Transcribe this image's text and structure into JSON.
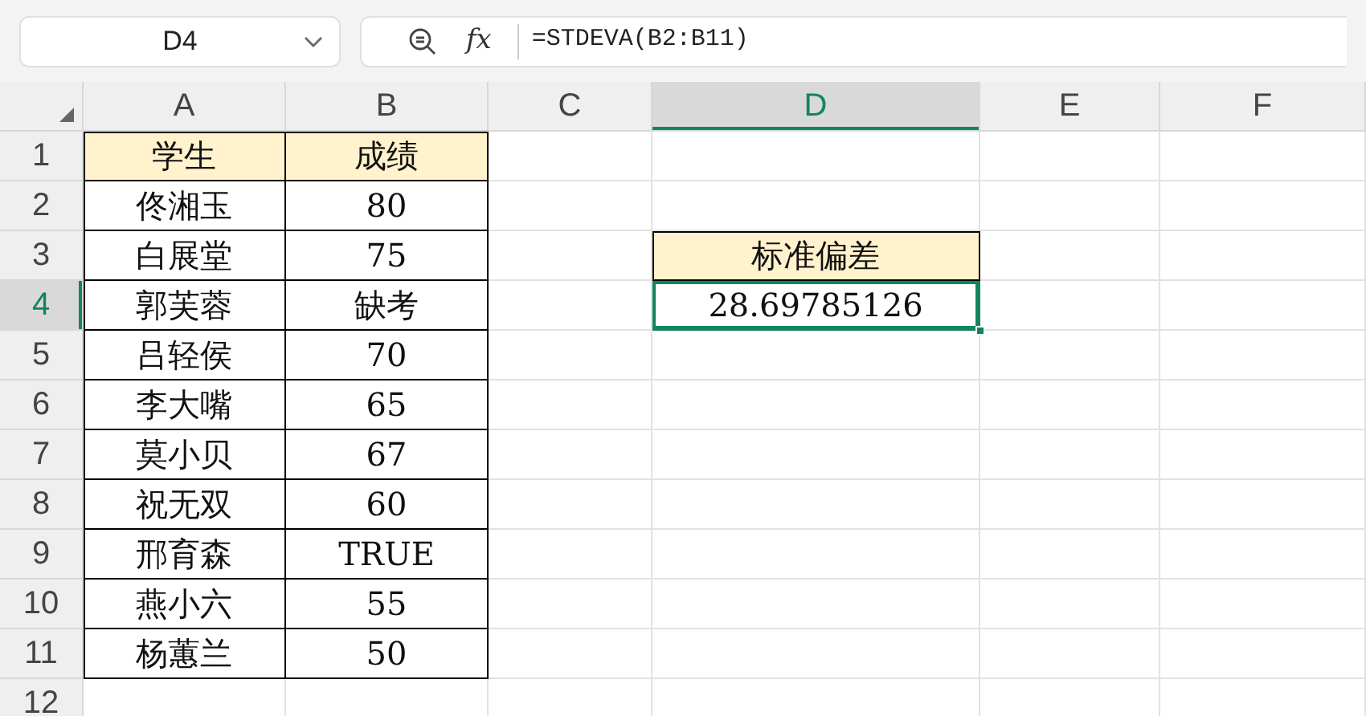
{
  "name_box": {
    "value": "D4"
  },
  "formula_bar": {
    "fx": "fx",
    "formula": "=STDEVA(B2:B11)"
  },
  "columns": [
    {
      "label": "A",
      "selected": false
    },
    {
      "label": "B",
      "selected": false
    },
    {
      "label": "C",
      "selected": false
    },
    {
      "label": "D",
      "selected": true
    },
    {
      "label": "E",
      "selected": false
    },
    {
      "label": "F",
      "selected": false
    }
  ],
  "rows": [
    {
      "label": "1",
      "selected": false,
      "cells": {
        "A": {
          "text": "学生",
          "kind": "header",
          "selected": false
        },
        "B": {
          "text": "成绩",
          "kind": "header",
          "selected": false
        }
      }
    },
    {
      "label": "2",
      "selected": false,
      "cells": {
        "A": {
          "text": "佟湘玉",
          "kind": "value",
          "selected": false
        },
        "B": {
          "text": "80",
          "kind": "value",
          "selected": false
        }
      }
    },
    {
      "label": "3",
      "selected": false,
      "cells": {
        "A": {
          "text": "白展堂",
          "kind": "value",
          "selected": false
        },
        "B": {
          "text": "75",
          "kind": "value",
          "selected": false
        },
        "D": {
          "text": "标准偏差",
          "kind": "header",
          "selected": false
        }
      }
    },
    {
      "label": "4",
      "selected": true,
      "cells": {
        "A": {
          "text": "郭芙蓉",
          "kind": "value",
          "selected": false
        },
        "B": {
          "text": "缺考",
          "kind": "value",
          "selected": false
        },
        "D": {
          "text": "28.69785126",
          "kind": "value",
          "selected": true
        }
      }
    },
    {
      "label": "5",
      "selected": false,
      "cells": {
        "A": {
          "text": "吕轻侯",
          "kind": "value",
          "selected": false
        },
        "B": {
          "text": "70",
          "kind": "value",
          "selected": false
        }
      }
    },
    {
      "label": "6",
      "selected": false,
      "cells": {
        "A": {
          "text": "李大嘴",
          "kind": "value",
          "selected": false
        },
        "B": {
          "text": "65",
          "kind": "value",
          "selected": false
        }
      }
    },
    {
      "label": "7",
      "selected": false,
      "cells": {
        "A": {
          "text": "莫小贝",
          "kind": "value",
          "selected": false
        },
        "B": {
          "text": "67",
          "kind": "value",
          "selected": false
        }
      }
    },
    {
      "label": "8",
      "selected": false,
      "cells": {
        "A": {
          "text": "祝无双",
          "kind": "value",
          "selected": false
        },
        "B": {
          "text": "60",
          "kind": "value",
          "selected": false
        }
      }
    },
    {
      "label": "9",
      "selected": false,
      "cells": {
        "A": {
          "text": "邢育森",
          "kind": "value",
          "selected": false
        },
        "B": {
          "text": "TRUE",
          "kind": "value",
          "selected": false
        }
      }
    },
    {
      "label": "10",
      "selected": false,
      "cells": {
        "A": {
          "text": "燕小六",
          "kind": "value",
          "selected": false
        },
        "B": {
          "text": "55",
          "kind": "value",
          "selected": false
        }
      }
    },
    {
      "label": "11",
      "selected": false,
      "cells": {
        "A": {
          "text": "杨蕙兰",
          "kind": "value",
          "selected": false
        },
        "B": {
          "text": "50",
          "kind": "value",
          "selected": false
        }
      }
    },
    {
      "label": "12",
      "selected": false
    }
  ]
}
